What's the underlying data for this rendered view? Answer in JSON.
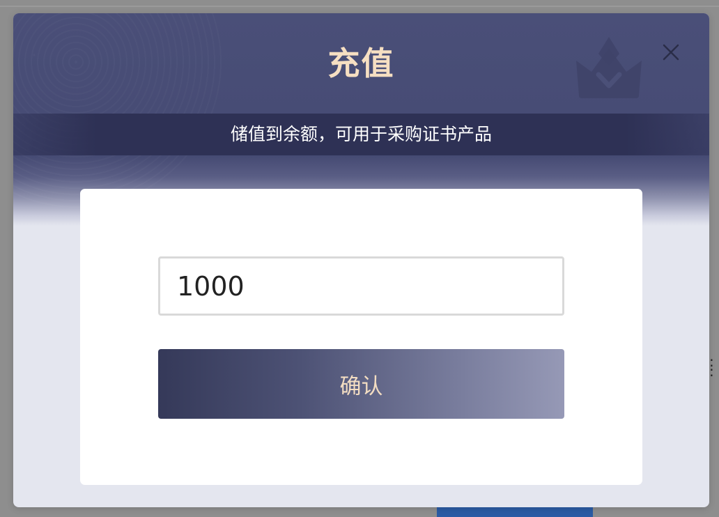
{
  "dialog": {
    "title": "充值",
    "subtitle": "储值到余额，可用于采购证书产品",
    "close_icon": "close-icon",
    "decor_icon": "crown-icon"
  },
  "form": {
    "amount_value": "1000",
    "confirm_label": "确认"
  },
  "colors": {
    "header_bg": "#4a4f78",
    "subtitle_band": "#2e3155",
    "title_text": "#f6dfc2",
    "button_start": "#353959",
    "button_end": "#9699b6",
    "button_text": "#f3ddc2",
    "backdrop": "#8e8e8e"
  }
}
